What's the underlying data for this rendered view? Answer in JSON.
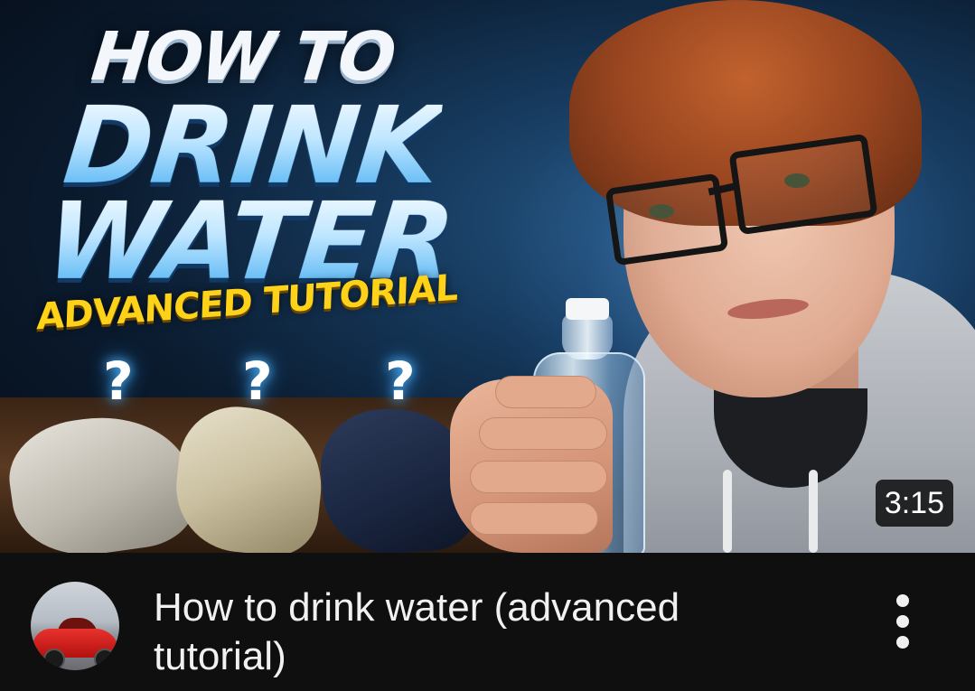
{
  "thumbnail": {
    "text_line1": "HOW TO",
    "text_line2": "DRINK",
    "text_line3": "WATER",
    "text_subtitle": "ADVANCED TUTORIAL",
    "question_mark": "?",
    "duration": "3:15"
  },
  "video": {
    "title": "How to drink water (advanced tutorial)",
    "more_icon": "more-vertical-icon"
  },
  "colors": {
    "background": "#0f0f0f",
    "title_text": "#f1f1f1",
    "subtitle_yellow": "#ffd21a",
    "water_blue": "#3aa8f0"
  }
}
